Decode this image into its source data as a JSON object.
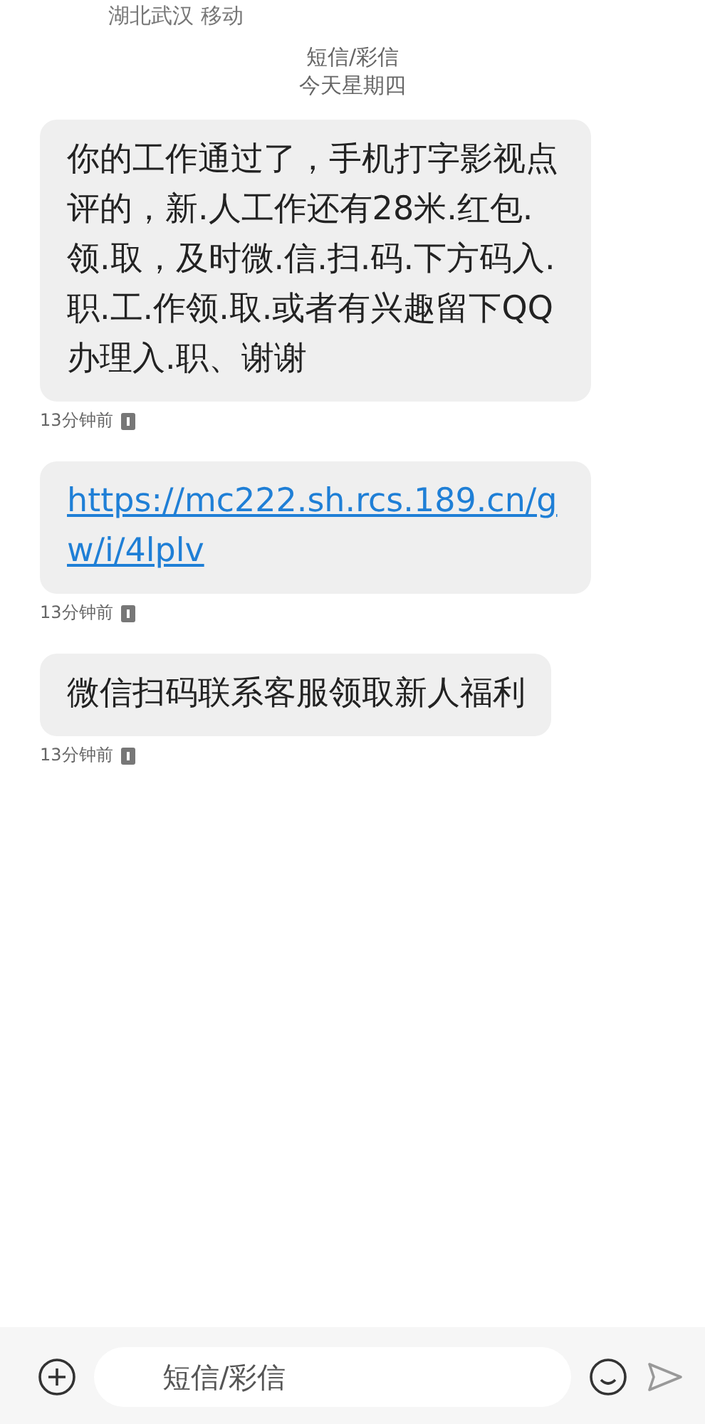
{
  "header": {
    "location": "湖北武汉 移动",
    "channel": "短信/彩信",
    "date": "今天星期四"
  },
  "messages": [
    {
      "kind": "text",
      "text": "你的工作通过了，手机打字影视点评的，新.人工作还有28米.红包.领.取，及时微.信.扫.码.下方码入.职.工.作领.取.或者有兴趣留下QQ办理入.职、谢谢",
      "time": "13分钟前"
    },
    {
      "kind": "link",
      "text": "https://mc222.sh.rcs.189.cn/gw/i/4lplv",
      "time": "13分钟前"
    },
    {
      "kind": "text",
      "text": "微信扫码联系客服领取新人福利",
      "time": "13分钟前"
    }
  ],
  "compose": {
    "placeholder": "短信/彩信"
  }
}
